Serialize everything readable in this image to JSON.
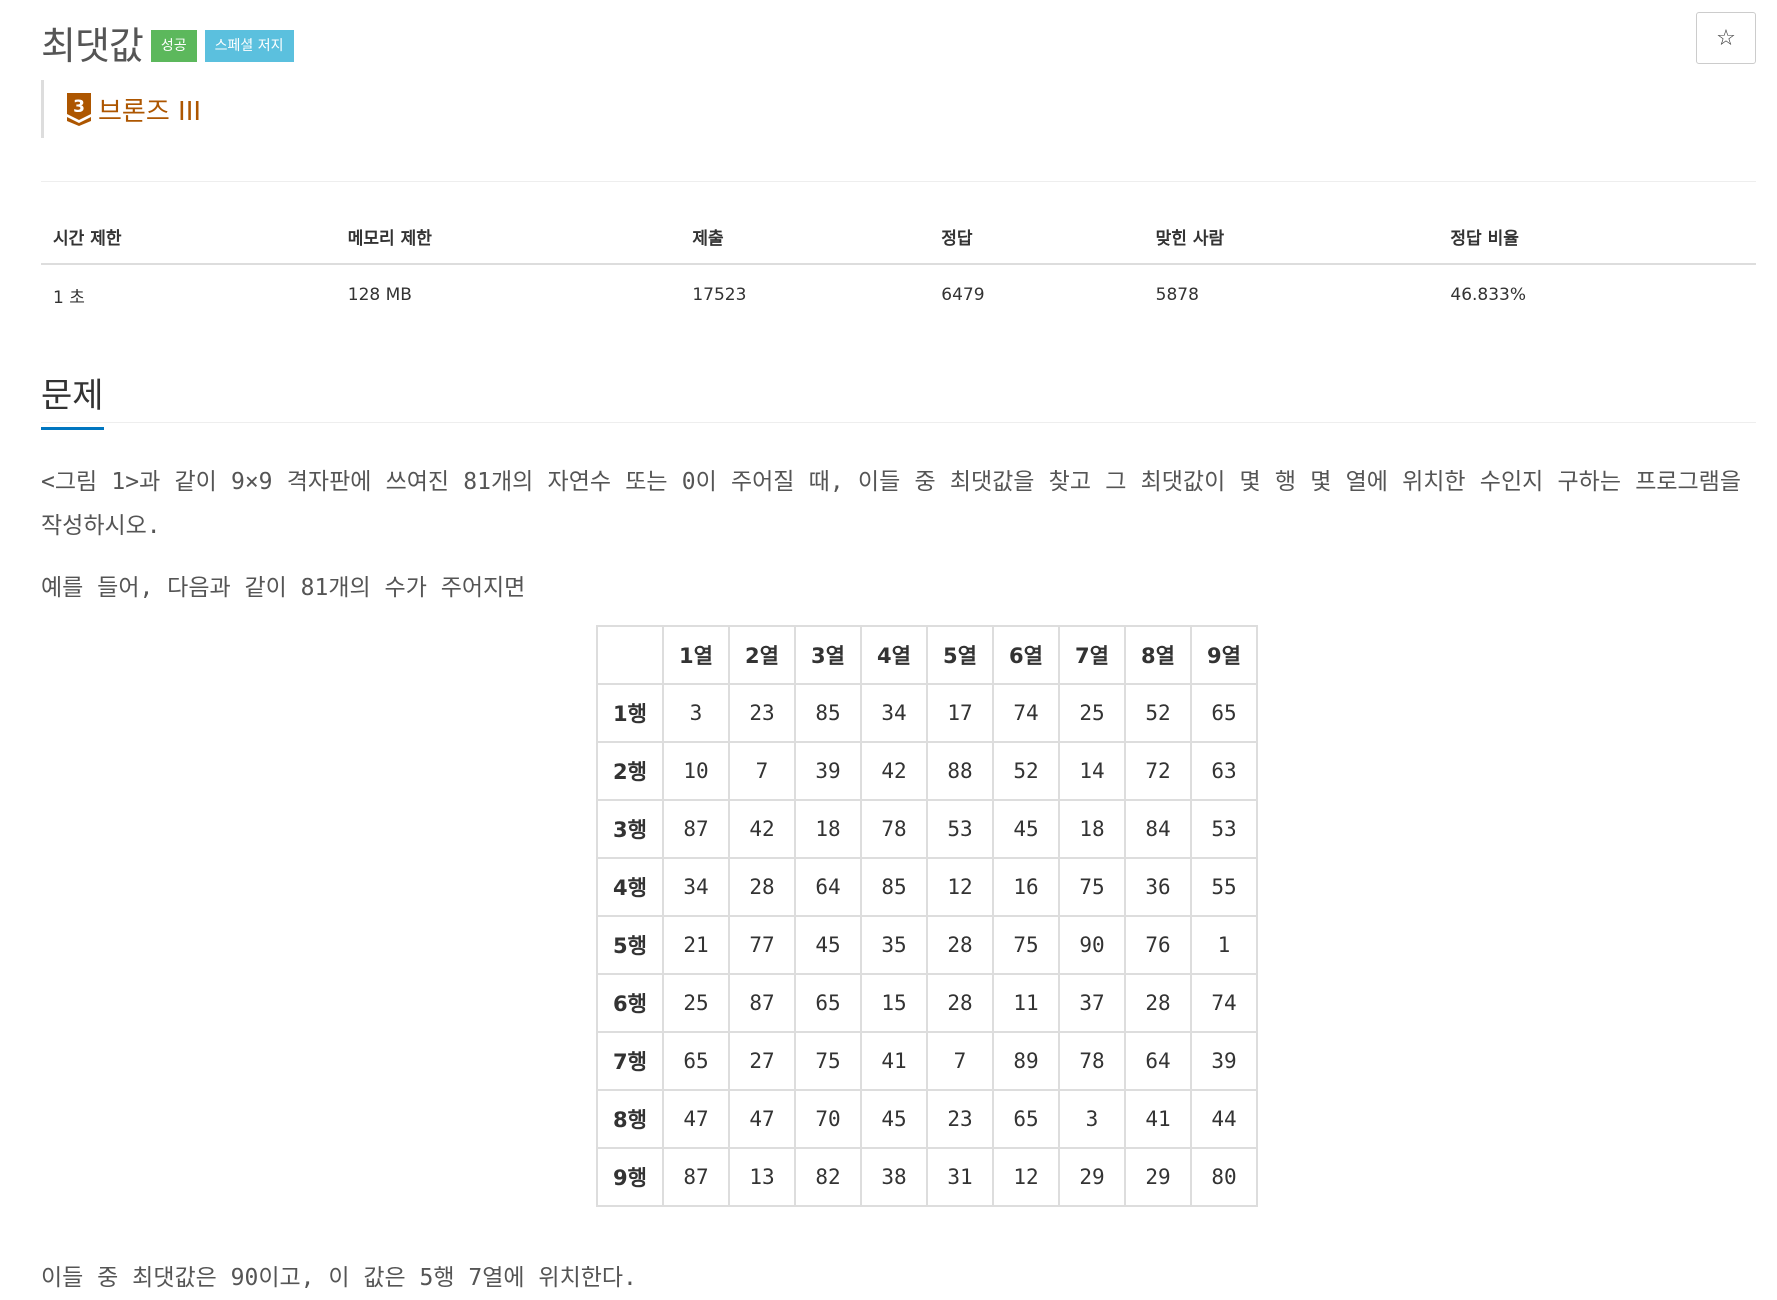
{
  "header": {
    "title": "최댓값",
    "badges": {
      "success": "성공",
      "special_judge": "스페셜 저지"
    },
    "star_glyph": "☆",
    "tier": {
      "number": "3",
      "label": "브론즈 III",
      "color": "#ad5600"
    }
  },
  "info": {
    "headers": [
      "시간 제한",
      "메모리 제한",
      "제출",
      "정답",
      "맞힌 사람",
      "정답 비율"
    ],
    "values": [
      "1 초",
      "128 MB",
      "17523",
      "6479",
      "5878",
      "46.833%"
    ]
  },
  "problem": {
    "heading": "문제",
    "paragraph1": "<그림 1>과 같이 9×9 격자판에 쓰여진 81개의 자연수 또는 0이 주어질 때, 이들 중 최댓값을 찾고 그 최댓값이 몇 행 몇 열에 위치한 수인지 구하는 프로그램을 작성하시오.",
    "paragraph2": "예를 들어, 다음과 같이 81개의 수가 주어지면",
    "paragraph3": "이들 중 최댓값은 90이고, 이 값은 5행 7열에 위치한다."
  },
  "grid": {
    "col_headers": [
      "1열",
      "2열",
      "3열",
      "4열",
      "5열",
      "6열",
      "7열",
      "8열",
      "9열"
    ],
    "rows": [
      {
        "label": "1행",
        "cells": [
          "3",
          "23",
          "85",
          "34",
          "17",
          "74",
          "25",
          "52",
          "65"
        ]
      },
      {
        "label": "2행",
        "cells": [
          "10",
          "7",
          "39",
          "42",
          "88",
          "52",
          "14",
          "72",
          "63"
        ]
      },
      {
        "label": "3행",
        "cells": [
          "87",
          "42",
          "18",
          "78",
          "53",
          "45",
          "18",
          "84",
          "53"
        ]
      },
      {
        "label": "4행",
        "cells": [
          "34",
          "28",
          "64",
          "85",
          "12",
          "16",
          "75",
          "36",
          "55"
        ]
      },
      {
        "label": "5행",
        "cells": [
          "21",
          "77",
          "45",
          "35",
          "28",
          "75",
          "90",
          "76",
          "1"
        ]
      },
      {
        "label": "6행",
        "cells": [
          "25",
          "87",
          "65",
          "15",
          "28",
          "11",
          "37",
          "28",
          "74"
        ]
      },
      {
        "label": "7행",
        "cells": [
          "65",
          "27",
          "75",
          "41",
          "7",
          "89",
          "78",
          "64",
          "39"
        ]
      },
      {
        "label": "8행",
        "cells": [
          "47",
          "47",
          "70",
          "45",
          "23",
          "65",
          "3",
          "41",
          "44"
        ]
      },
      {
        "label": "9행",
        "cells": [
          "87",
          "13",
          "82",
          "38",
          "31",
          "12",
          "29",
          "29",
          "80"
        ]
      }
    ]
  }
}
